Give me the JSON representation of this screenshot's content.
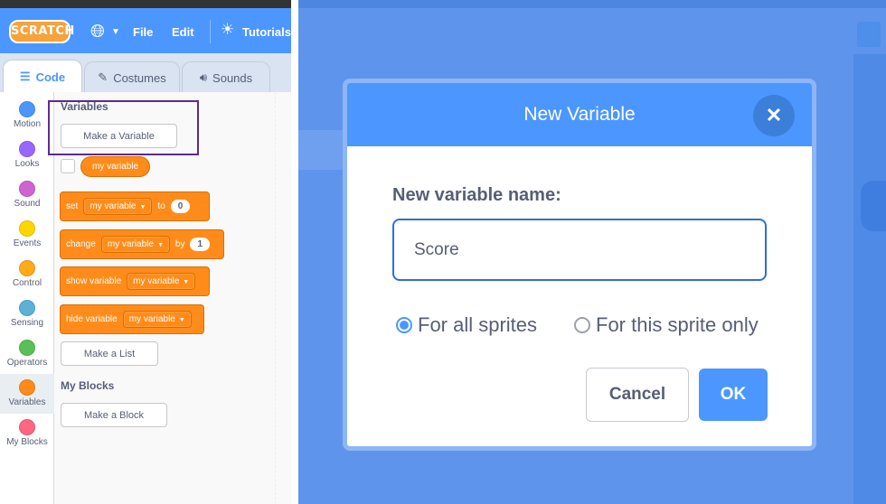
{
  "menubar": {
    "logo": "SCRATCH",
    "globe_icon": "globe-icon",
    "items": [
      "File",
      "Edit"
    ],
    "tutorials": "Tutorials"
  },
  "tabs": [
    {
      "label": "Code",
      "icon": "code-icon",
      "active": true
    },
    {
      "label": "Costumes",
      "icon": "brush-icon",
      "active": false
    },
    {
      "label": "Sounds",
      "icon": "speaker-icon",
      "active": false
    }
  ],
  "categories": [
    {
      "label": "Motion",
      "color": "#4c97ff"
    },
    {
      "label": "Looks",
      "color": "#9966ff"
    },
    {
      "label": "Sound",
      "color": "#cf63cf"
    },
    {
      "label": "Events",
      "color": "#ffd500"
    },
    {
      "label": "Control",
      "color": "#ffab19"
    },
    {
      "label": "Sensing",
      "color": "#5cb1d6"
    },
    {
      "label": "Operators",
      "color": "#59c059"
    },
    {
      "label": "Variables",
      "color": "#ff8c1a",
      "active": true
    },
    {
      "label": "My Blocks",
      "color": "#ff6680"
    }
  ],
  "palette": {
    "variables_title": "Variables",
    "make_variable": "Make a Variable",
    "variable_reporter": "my variable",
    "set_block": {
      "verb": "set",
      "var": "my variable",
      "prep": "to",
      "value": "0"
    },
    "change_block": {
      "verb": "change",
      "var": "my variable",
      "prep": "by",
      "value": "1"
    },
    "show_block": {
      "verb": "show variable",
      "var": "my variable"
    },
    "hide_block": {
      "verb": "hide variable",
      "var": "my variable"
    },
    "make_list": "Make a List",
    "myblocks_title": "My Blocks",
    "make_block": "Make a Block"
  },
  "dialog": {
    "title": "New Variable",
    "close_icon": "close-icon",
    "field_label": "New variable name:",
    "input_value": "Score",
    "radio_all": "For all sprites",
    "radio_this": "For this sprite only",
    "selected_scope": "all",
    "cancel": "Cancel",
    "ok": "OK"
  }
}
